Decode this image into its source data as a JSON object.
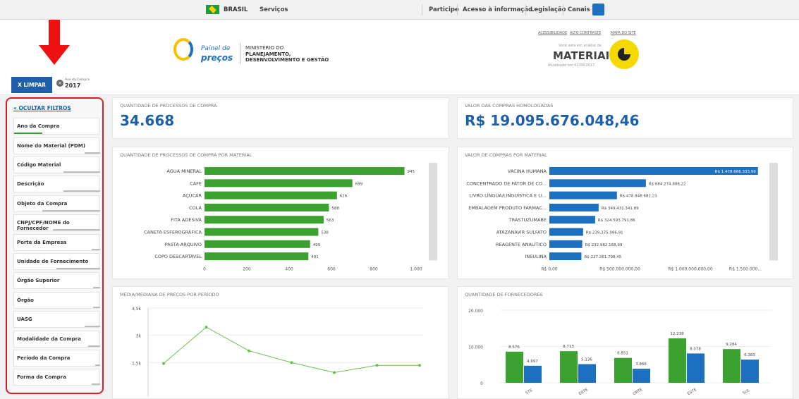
{
  "gov": {
    "country": "BRASIL",
    "servicos": "Serviços",
    "links": [
      "Participe",
      "Acesso à informação",
      "Legislação",
      "Canais"
    ]
  },
  "header": {
    "top_links": [
      "ACESSIBILIDADE",
      "ALTO CONTRASTE",
      "MAPA DO SITE"
    ],
    "logo_line1": "Painel de",
    "logo_line2": "preços",
    "ministry1": "MINISTÉRIO DO",
    "ministry2": "PLANEJAMENTO,",
    "ministry3": "DESENVOLVIMENTO E GESTÃO",
    "viewing_label": "Você está em análise de",
    "area": "MATERIAIS",
    "updated": "Atualizado em 02/08/2017"
  },
  "filterbar": {
    "clear_label": "X  LIMPAR",
    "selection_key": "Ano da Compra",
    "selection_value": "2017"
  },
  "sidebar": {
    "hide_label": "« OCULTAR FILTROS",
    "items": [
      "Ano da Compra",
      "Nome do Material (PDM)",
      "Código Material",
      "Descrição",
      "Objeto da Compra",
      "CNPJ/CPF/NOME do Fornecedor",
      "Porte da Empresa",
      "Unidade de Fornecimento",
      "Órgão Superior",
      "Órgão",
      "UASG",
      "Modalidade da Compra",
      "Período da Compra",
      "Forma da Compra"
    ]
  },
  "kpis": {
    "qtd_title": "QUANTIDADE DE PROCESSOS DE COMPRA",
    "qtd_value": "34.668",
    "valor_title": "VALOR DAS COMPRAS HOMOLOGADAS",
    "valor_value": "R$ 19.095.676.048,46"
  },
  "chart_data": [
    {
      "type": "bar",
      "orientation": "horizontal",
      "title": "QUANTIDADE DE PROCESSOS DE COMPRA POR MATERIAL",
      "categories": [
        "ÁGUA MINERAL",
        "CAFÉ",
        "AÇÚCAR",
        "COLA",
        "FITA ADESIVA",
        "CANETA ESFEROGRÁFICA",
        "PASTA ARQUIVO",
        "COPO DESCARTÁVEL"
      ],
      "values": [
        945,
        699,
        626,
        588,
        563,
        538,
        499,
        491
      ],
      "value_labels": [
        "945",
        "699",
        "626",
        "588",
        "563",
        "538",
        "499",
        "491"
      ],
      "xticks": [
        "0",
        "200",
        "400",
        "600",
        "800",
        "1.000"
      ],
      "xlim": [
        0,
        1000
      ],
      "color": "#3ba22f"
    },
    {
      "type": "bar",
      "orientation": "horizontal",
      "title": "VALOR DE COMPRAS POR MATERIAL",
      "categories": [
        "VACINA HUMANA",
        "CONCENTRADO DE FATOR DE CO...",
        "LIVRO LÍNGUA/LINGUÍSTICA E LI...",
        "EMBALAGEM PRODUTO FARMAC...",
        "TRASTUZUMABE",
        "ATAZANAVIR SULFATO",
        "REAGENTE ANALÍTICO",
        "INSULINA"
      ],
      "values": [
        1478666333.99,
        684274886.22,
        478846682.23,
        349431341.89,
        324593791.86,
        239275086.91,
        232982168.99,
        227261798.45
      ],
      "value_labels": [
        "R$ 1.478.666.333,99",
        "R$ 684.274.886,22",
        "R$ 478.846.682,23",
        "R$ 349.431.341,89",
        "R$ 324.593.791,86",
        "R$ 239.275.086,91",
        "R$ 232.982.168,99",
        "R$ 227.261.798,45"
      ],
      "xticks": [
        "R$ 0,00",
        "R$ 500.000.000,00",
        "R$ 1.000.000.000,00",
        "R$ 1.500.000..."
      ],
      "xlim": [
        0,
        1500000000
      ],
      "color": "#1d6fbf"
    },
    {
      "type": "line",
      "title": "MÉDIA/MEDIANA DE PREÇOS POR PERÍODO",
      "yticks": [
        "4,5k",
        "3k",
        "1,5k"
      ],
      "values": [
        1450,
        3450,
        2150,
        1500,
        950,
        1350,
        1350
      ],
      "color": "#66c24b"
    },
    {
      "type": "bar",
      "title": "QUANTIDADE DE FORNECEDORES",
      "categories": [
        "NORDESTE",
        "SUDESTE",
        "NORTE",
        "CENTRO-OESTE",
        "SUL"
      ],
      "series": [
        {
          "values": [
            8576,
            8713,
            6851,
            12238,
            9284
          ],
          "labels": [
            "8.576",
            "8.713",
            "6.851",
            "12.238",
            "9.284"
          ],
          "color": "#3ba22f"
        },
        {
          "values": [
            4697,
            5136,
            3866,
            8078,
            6383
          ],
          "labels": [
            "4.697",
            "5.136",
            "3.866",
            "8.078",
            "6.383"
          ],
          "color": "#1d6fbf"
        }
      ],
      "yticks": [
        "20.000",
        "10.000",
        "0"
      ],
      "ylim": [
        0,
        20000
      ],
      "xlabels_visible": [
        "STE",
        "ESTE",
        "ORTE",
        "ESTE",
        "SUL"
      ]
    }
  ]
}
